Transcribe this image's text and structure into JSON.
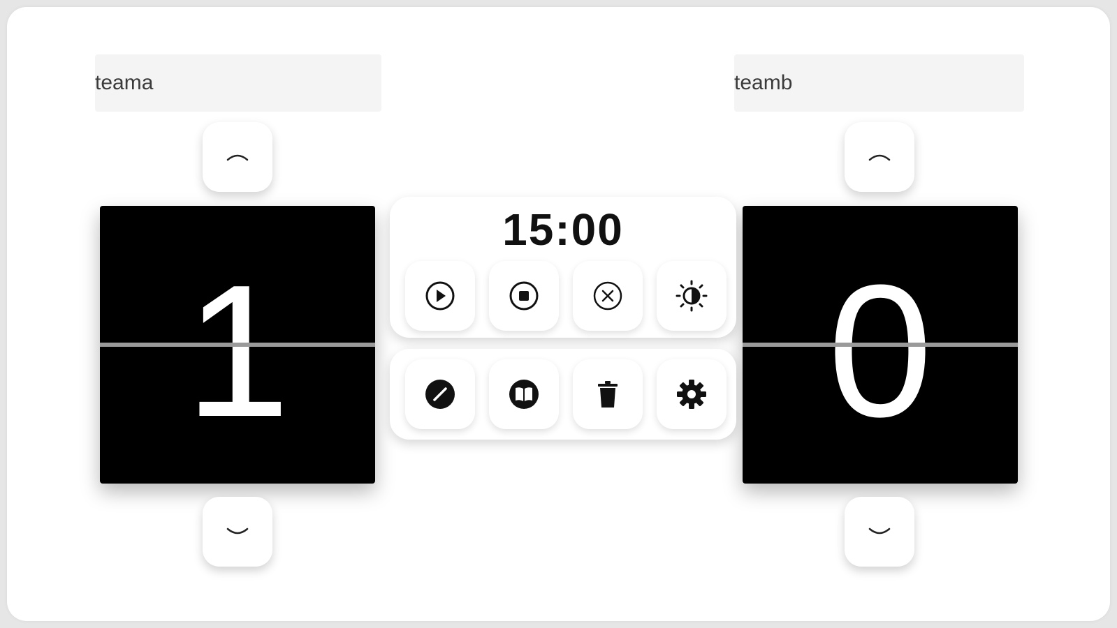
{
  "team_a": {
    "name": "teama",
    "score": "1"
  },
  "team_b": {
    "name": "teamb",
    "score": "0"
  },
  "timer": {
    "display": "15:00"
  },
  "timer_controls": [
    {
      "name": "play",
      "icon": "play-circle-icon"
    },
    {
      "name": "stop",
      "icon": "stop-circle-icon"
    },
    {
      "name": "reset",
      "icon": "close-circle-icon"
    },
    {
      "name": "brightness",
      "icon": "brightness-icon"
    }
  ],
  "tool_controls": [
    {
      "name": "edit",
      "icon": "pencil-circle-icon"
    },
    {
      "name": "rules",
      "icon": "book-icon"
    },
    {
      "name": "delete",
      "icon": "trash-icon"
    },
    {
      "name": "settings",
      "icon": "gear-icon"
    }
  ],
  "colors": {
    "score_background": "#000000",
    "score_text": "#ffffff",
    "score_divider": "#9a9a9a",
    "input_background": "#f4f4f4",
    "icon": "#111111"
  }
}
